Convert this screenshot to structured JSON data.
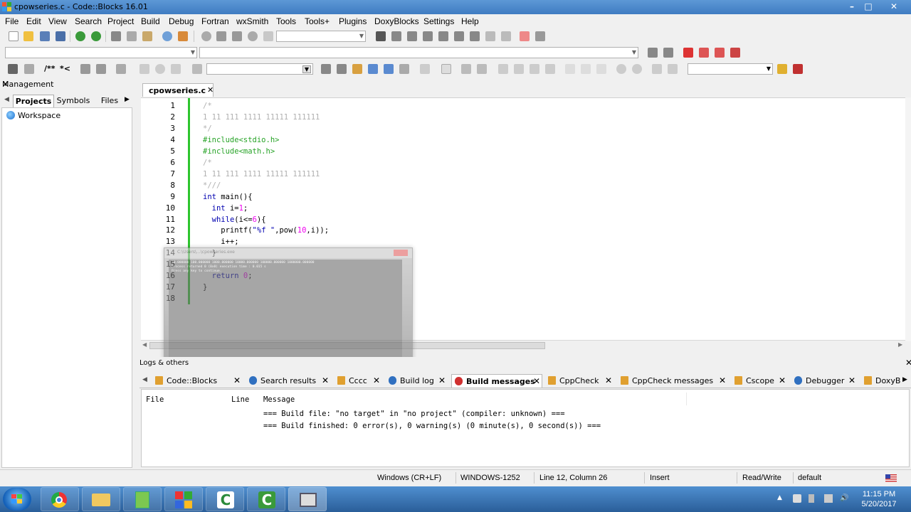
{
  "window": {
    "title": "cpowseries.c - Code::Blocks 16.01",
    "buttons": {
      "minimize": "–",
      "maximize": "□",
      "close": "✕"
    }
  },
  "menu": [
    "File",
    "Edit",
    "View",
    "Search",
    "Project",
    "Build",
    "Debug",
    "Fortran",
    "wxSmith",
    "Tools",
    "Tools+",
    "Plugins",
    "DoxyBlocks",
    "Settings",
    "Help"
  ],
  "toolbar": {
    "comment_label": "/**",
    "comment_label2": "*<",
    "search_combo_value": ""
  },
  "management": {
    "title": "Management",
    "close": "✕",
    "tabs": [
      "Projects",
      "Symbols",
      "Files"
    ],
    "active_tab": "Projects",
    "workspace": "Workspace"
  },
  "editor": {
    "tab_label": "cpowseries.c",
    "tab_close": "✕",
    "lines": [
      {
        "n": "1",
        "tokens": [
          {
            "t": "/*",
            "c": "cm"
          }
        ]
      },
      {
        "n": "2",
        "tokens": [
          {
            "t": "1 11 111 1111 11111 111111",
            "c": "cm"
          }
        ]
      },
      {
        "n": "3",
        "tokens": [
          {
            "t": "*/",
            "c": "cm"
          }
        ]
      },
      {
        "n": "4",
        "tokens": [
          {
            "t": "#include<stdio.h>",
            "c": "pp"
          }
        ]
      },
      {
        "n": "5",
        "tokens": [
          {
            "t": "#include<math.h>",
            "c": "pp"
          }
        ]
      },
      {
        "n": "6",
        "tokens": [
          {
            "t": "/*",
            "c": "cm"
          }
        ]
      },
      {
        "n": "7",
        "tokens": [
          {
            "t": "1 11 111 1111 11111 111111",
            "c": "cm"
          }
        ]
      },
      {
        "n": "8",
        "tokens": [
          {
            "t": "*///",
            "c": "cm"
          }
        ]
      },
      {
        "n": "9",
        "tokens": [
          {
            "t": "int",
            "c": "kw"
          },
          {
            "t": " main(){",
            "c": "df"
          }
        ]
      },
      {
        "n": "10",
        "tokens": [
          {
            "t": "  ",
            "c": "df"
          },
          {
            "t": "int",
            "c": "kw"
          },
          {
            "t": " i=",
            "c": "df"
          },
          {
            "t": "1",
            "c": "num"
          },
          {
            "t": ";",
            "c": "df"
          }
        ]
      },
      {
        "n": "11",
        "tokens": [
          {
            "t": "  ",
            "c": "df"
          },
          {
            "t": "while",
            "c": "kw"
          },
          {
            "t": "(i<=",
            "c": "df"
          },
          {
            "t": "6",
            "c": "num"
          },
          {
            "t": "){",
            "c": "df"
          }
        ]
      },
      {
        "n": "12",
        "tokens": [
          {
            "t": "    printf(",
            "c": "df"
          },
          {
            "t": "\"%f \"",
            "c": "str"
          },
          {
            "t": ",pow(",
            "c": "df"
          },
          {
            "t": "10",
            "c": "num"
          },
          {
            "t": ",i));",
            "c": "df"
          }
        ]
      },
      {
        "n": "13",
        "tokens": [
          {
            "t": "    i++;",
            "c": "df"
          }
        ]
      },
      {
        "n": "14",
        "tokens": [
          {
            "t": "  }",
            "c": "df"
          }
        ]
      },
      {
        "n": "15",
        "tokens": [
          {
            "t": "",
            "c": "df"
          }
        ]
      },
      {
        "n": "16",
        "tokens": [
          {
            "t": "  ",
            "c": "df"
          },
          {
            "t": "return",
            "c": "kw"
          },
          {
            "t": " ",
            "c": "df"
          },
          {
            "t": "0",
            "c": "num"
          },
          {
            "t": ";",
            "c": "df"
          }
        ]
      },
      {
        "n": "17",
        "tokens": [
          {
            "t": "}",
            "c": "df"
          }
        ]
      },
      {
        "n": "18",
        "tokens": [
          {
            "t": "",
            "c": "df"
          }
        ]
      }
    ]
  },
  "console_preview": {
    "title": "C:\\Users\\...\\cpowseries.exe",
    "lines": [
      "10.000000 100.000000 1000.000000 10000.000000 100000.000000 1000000.000000",
      "Process returned 0 (0x0)   execution time : 0.015 s",
      "Press any key to continue."
    ]
  },
  "logs": {
    "title": "Logs & others",
    "close": "✕",
    "tabs": [
      {
        "label": "Code::Blocks",
        "icon": "pencil-icon",
        "color": "#e0a030"
      },
      {
        "label": "Search results",
        "icon": "search-icon",
        "color": "#3070c0"
      },
      {
        "label": "Cccc",
        "icon": "pencil-icon",
        "color": "#e0a030"
      },
      {
        "label": "Build log",
        "icon": "gear-icon",
        "color": "#3070c0"
      },
      {
        "label": "Build messages",
        "icon": "pin-icon",
        "color": "#d03030"
      },
      {
        "label": "CppCheck",
        "icon": "pencil-icon",
        "color": "#e0a030"
      },
      {
        "label": "CppCheck messages",
        "icon": "pencil-icon",
        "color": "#e0a030"
      },
      {
        "label": "Cscope",
        "icon": "pencil-icon",
        "color": "#e0a030"
      },
      {
        "label": "Debugger",
        "icon": "gear-icon",
        "color": "#3070c0"
      },
      {
        "label": "DoxyB",
        "icon": "pencil-icon",
        "color": "#e0a030"
      }
    ],
    "active_tab": "Build messages",
    "columns": [
      "File",
      "Line",
      "Message"
    ],
    "messages": [
      "=== Build file: \"no target\" in \"no project\" (compiler: unknown) ===",
      "=== Build finished: 0 error(s), 0 warning(s) (0 minute(s), 0 second(s)) ==="
    ]
  },
  "status": {
    "line_endings": "Windows (CR+LF)",
    "encoding": "WINDOWS-1252",
    "position": "Line 12, Column 26",
    "mode": "Insert",
    "access": "Read/Write",
    "profile": "default"
  },
  "taskbar": {
    "time": "11:15 PM",
    "date": "5/20/2017",
    "apps": [
      "chrome-icon",
      "folder-icon",
      "notepad-icon",
      "office-icon",
      "camtasia-icon",
      "camtasia-recorder-icon",
      "codeblocks-console-icon"
    ]
  },
  "colors": {
    "accent_green": "#2ec52e",
    "title_bar": "#4a88ca",
    "taskbar": "#3a72b0"
  }
}
